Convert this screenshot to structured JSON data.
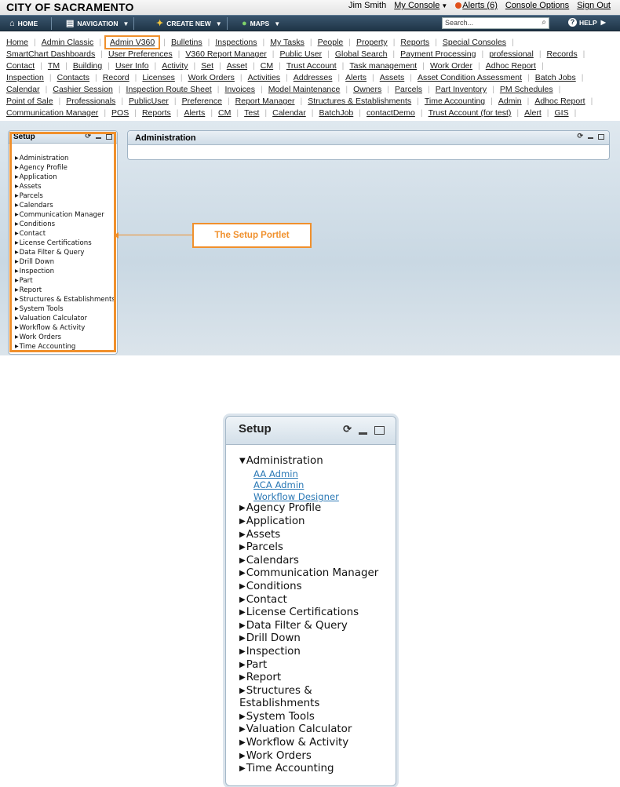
{
  "header": {
    "city": "CITY OF SACRAMENTO",
    "user": "Jim Smith",
    "my_console": "My Console",
    "alerts": "Alerts (6)",
    "console_options": "Console Options",
    "sign_out": "Sign Out"
  },
  "nav": {
    "home": "HOME",
    "navigation": "NAVIGATION",
    "create_new": "CREATE NEW",
    "maps": "MAPS",
    "search_placeholder": "Search...",
    "help": "HELP"
  },
  "link_rows": [
    [
      "Home",
      "Admin Classic",
      "Admin V360",
      "Bulletins",
      "Inspections",
      "My Tasks",
      "People",
      "Property",
      "Reports",
      "Special Consoles"
    ],
    [
      "SmartChart Dashboards",
      "User Preferences",
      "V360 Report Manager",
      "Public User",
      "Global Search",
      "Payment Processing",
      "professional",
      "Records"
    ],
    [
      "Contact",
      "TM",
      "Building",
      "User Info",
      "Activity",
      "Set",
      "Asset",
      "CM",
      "Trust Account",
      "Task management",
      "Work Order",
      "Adhoc Report"
    ],
    [
      "Inspection",
      "Contacts",
      "Record",
      "Licenses",
      "Work Orders",
      "Activities",
      "Addresses",
      "Alerts",
      "Assets",
      "Asset Condition Assessment",
      "Batch Jobs"
    ],
    [
      "Calendar",
      "Cashier Session",
      "Inspection Route Sheet",
      "Invoices",
      "Model Maintenance",
      "Owners",
      "Parcels",
      "Part Inventory",
      "PM Schedules"
    ],
    [
      "Point of Sale",
      "Professionals",
      "PublicUser",
      "Preference",
      "Report Manager",
      "Structures & Establishments",
      "Time Accounting",
      "Admin",
      "Adhoc Report"
    ],
    [
      "Communication Manager",
      "POS",
      "Reports",
      "Alerts",
      "CM",
      "Test",
      "Calendar",
      "BatchJob",
      "contactDemo",
      "Trust Account (for test)",
      "Alert",
      "GIS"
    ]
  ],
  "highlighted_link": "Admin V360",
  "setup_portlet": {
    "title": "Setup",
    "items": [
      "Administration",
      "Agency Profile",
      "Application",
      "Assets",
      "Parcels",
      "Calendars",
      "Communication Manager",
      "Conditions",
      "Contact",
      "License Certifications",
      "Data Filter & Query",
      "Drill Down",
      "Inspection",
      "Part",
      "Report",
      "Structures & Establishments",
      "System Tools",
      "Valuation Calculator",
      "Workflow & Activity",
      "Work Orders",
      "Time Accounting"
    ]
  },
  "admin_portlet": {
    "title": "Administration"
  },
  "callout": {
    "label": "The Setup Portlet"
  },
  "zoom_portlet": {
    "title": "Setup",
    "expanded_item": "Administration",
    "sub_items": [
      "AA Admin",
      "ACA Admin",
      "Workflow Designer"
    ],
    "items": [
      "Agency Profile",
      "Application",
      "Assets",
      "Parcels",
      "Calendars",
      "Communication Manager",
      "Conditions",
      "Contact",
      "License Certifications",
      "Data Filter & Query",
      "Drill Down",
      "Inspection",
      "Part",
      "Report",
      "Structures & Establishments",
      "System Tools",
      "Valuation Calculator",
      "Workflow & Activity",
      "Work Orders",
      "Time Accounting"
    ]
  },
  "colors": {
    "accent": "#f0902c",
    "nav_bar": "#1f3547",
    "link_blue": "#2a78b5"
  },
  "icons": [
    "home-icon",
    "navigation-icon",
    "create-new-icon",
    "globe-icon",
    "search-icon",
    "help-icon",
    "refresh-icon",
    "minimize-icon",
    "maximize-icon",
    "alert-icon"
  ]
}
